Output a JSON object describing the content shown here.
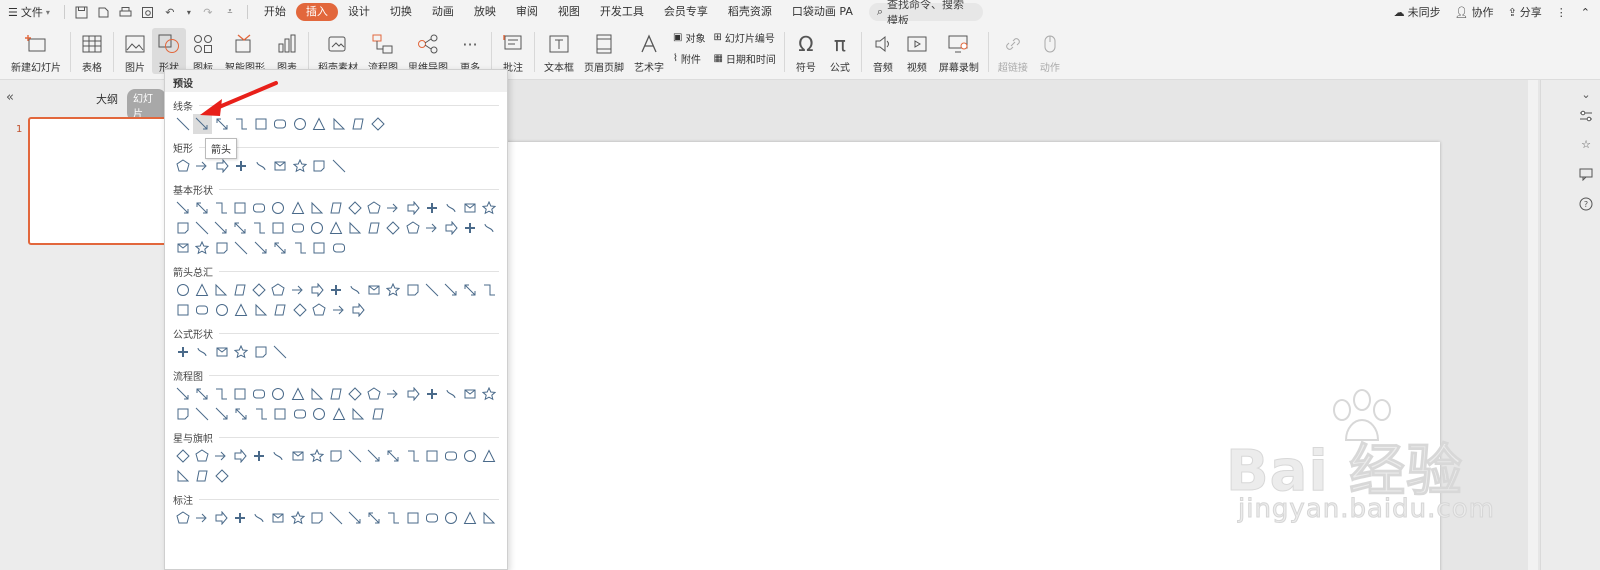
{
  "menubar": {
    "file_label": "文件",
    "tabs": [
      {
        "label": "开始",
        "active": false
      },
      {
        "label": "插入",
        "active": true
      },
      {
        "label": "设计",
        "active": false
      },
      {
        "label": "切换",
        "active": false
      },
      {
        "label": "动画",
        "active": false
      },
      {
        "label": "放映",
        "active": false
      },
      {
        "label": "审阅",
        "active": false
      },
      {
        "label": "视图",
        "active": false
      },
      {
        "label": "开发工具",
        "active": false
      },
      {
        "label": "会员专享",
        "active": false
      },
      {
        "label": "稻壳资源",
        "active": false
      },
      {
        "label": "口袋动画 PA",
        "active": false
      }
    ],
    "search_placeholder": "查找命令、搜索模板",
    "sync": "未同步",
    "collab": "协作",
    "share": "分享"
  },
  "ribbon": {
    "new_slide": "新建幻灯片",
    "table": "表格",
    "picture": "图片",
    "shape": "形状",
    "icon": "图标",
    "smartart": "智能图形",
    "chart": "图表",
    "docer": "稻壳素材",
    "flowchart": "流程图",
    "mindmap": "思维导图",
    "more": "更多",
    "comment": "批注",
    "textbox": "文本框",
    "header_footer": "页眉页脚",
    "wordart": "艺术字",
    "object": "对象",
    "attachment": "附件",
    "slide_number": "幻灯片编号",
    "date_time": "日期和时间",
    "symbol": "符号",
    "formula": "公式",
    "audio": "音频",
    "video": "视频",
    "screen_record": "屏幕录制",
    "hyperlink": "超链接",
    "action": "动作"
  },
  "leftpanel": {
    "outline": "大纲",
    "slides": "幻灯片",
    "slide_number": "1"
  },
  "dropdown": {
    "header": "预设",
    "tooltip": "箭头",
    "sections": [
      {
        "title": "线条",
        "rows": [
          11
        ]
      },
      {
        "title": "矩形",
        "rows": [
          9
        ]
      },
      {
        "title": "基本形状",
        "rows": [
          17,
          17,
          9
        ]
      },
      {
        "title": "箭头总汇",
        "rows": [
          17,
          10
        ]
      },
      {
        "title": "公式形状",
        "rows": [
          6
        ]
      },
      {
        "title": "流程图",
        "rows": [
          17,
          11
        ]
      },
      {
        "title": "星与旗帜",
        "rows": [
          17,
          3
        ]
      },
      {
        "title": "标注",
        "rows": [
          17
        ]
      }
    ]
  },
  "watermark": {
    "brand": "Bai 经验",
    "url": "jingyan.baidu.com"
  },
  "colors": {
    "accent": "#e2673c",
    "shape_stroke": "#4a6a8a"
  }
}
